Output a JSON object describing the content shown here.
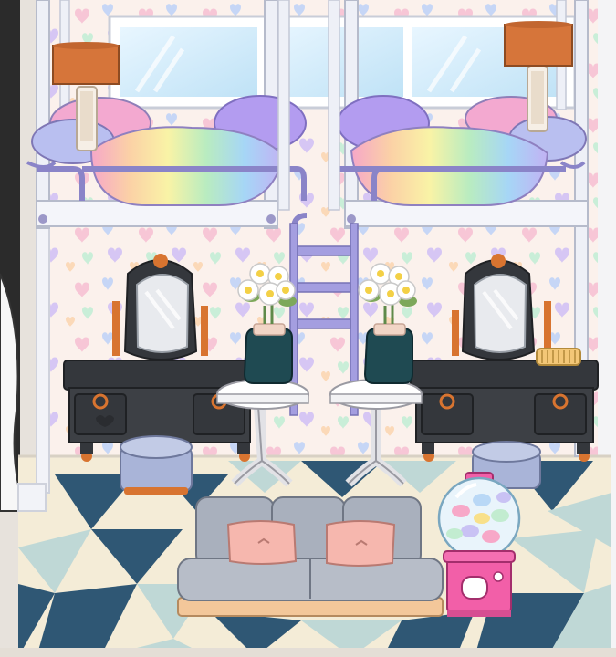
{
  "scene": {
    "type": "dollhouse-bedroom",
    "objects": [
      "bunk-bed-left",
      "bunk-bed-right",
      "ladder",
      "lamp-left",
      "lamp-right",
      "vanity-left",
      "vanity-right",
      "flower-vase-left",
      "flower-vase-right",
      "side-table-left",
      "side-table-right",
      "pouf-left",
      "pouf-right",
      "sofa",
      "gumball-machine",
      "comb"
    ]
  },
  "colors": {
    "wall": "#f8eee8",
    "floor_navy": "#2f5774",
    "floor_cream": "#f4ecd7",
    "floor_mint": "#bfd8d6",
    "frame": "#eef0f7",
    "vanity": "#34373c",
    "accent_orange": "#d87430",
    "lamp_shade": "#d6753a",
    "bedding_purple": "#b39cf0",
    "bedding_pink": "#f3a9d0",
    "sofa_gray": "#a9b0bd",
    "cushion_pink": "#f6b7ae",
    "gumball_pink": "#f25fa8",
    "vase_teal": "#1f4a52",
    "pouf_lavender": "#a9b4d8"
  }
}
